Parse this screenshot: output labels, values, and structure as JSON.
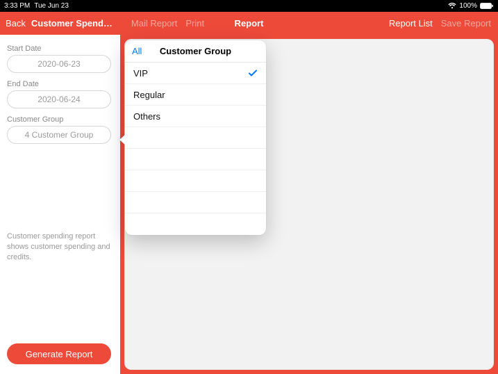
{
  "status_bar": {
    "time": "3:33 PM",
    "date": "Tue Jun 23",
    "battery_pct": "100%"
  },
  "header": {
    "back_label": "Back",
    "title": "Customer Spending...",
    "mail_report": "Mail Report",
    "print": "Print",
    "center_title": "Report",
    "report_list": "Report List",
    "save_report": "Save Report"
  },
  "sidebar": {
    "start_date_label": "Start Date",
    "start_date_value": "2020-06-23",
    "end_date_label": "End Date",
    "end_date_value": "2020-06-24",
    "customer_group_label": "Customer Group",
    "customer_group_value": "4 Customer Group",
    "description": "Customer spending report shows customer spending and credits.",
    "generate_label": "Generate Report"
  },
  "popover": {
    "all_label": "All",
    "title": "Customer Group",
    "options": [
      {
        "label": "VIP",
        "selected": true
      },
      {
        "label": "Regular",
        "selected": false
      },
      {
        "label": "Others",
        "selected": false
      },
      {
        "label": "",
        "selected": false
      },
      {
        "label": "",
        "selected": false
      },
      {
        "label": "",
        "selected": false
      },
      {
        "label": "",
        "selected": false
      }
    ]
  }
}
